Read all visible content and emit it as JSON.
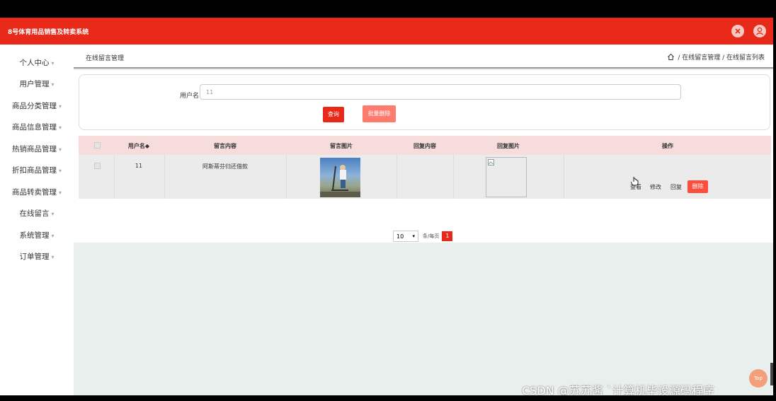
{
  "app": {
    "title": "8号体育用品销售及转卖系统"
  },
  "sidebar": {
    "items": [
      {
        "label": "个人中心"
      },
      {
        "label": "用户管理"
      },
      {
        "label": "商品分类管理"
      },
      {
        "label": "商品信息管理"
      },
      {
        "label": "热销商品管理"
      },
      {
        "label": "折扣商品管理"
      },
      {
        "label": "商品转卖管理"
      },
      {
        "label": "在线留言"
      },
      {
        "label": "系统管理"
      },
      {
        "label": "订单管理"
      }
    ],
    "caret": "▾"
  },
  "header": {
    "page_title": "在线留言管理",
    "breadcrumb": "/ 在线留言管理 / 在线留言列表"
  },
  "search": {
    "label": "用户名",
    "value": "11",
    "query_label": "查询",
    "batch_delete_label": "批量删除"
  },
  "table": {
    "columns": [
      "用户名◆",
      "留言内容",
      "留言图片",
      "回复内容",
      "回复图片",
      "操作"
    ],
    "rows": [
      {
        "username": "11",
        "content": "阿斯蒂芬归还借款",
        "reply": ""
      }
    ],
    "actions": {
      "view": "查看",
      "edit": "修改",
      "reply": "回复",
      "delete": "删除"
    }
  },
  "pagination": {
    "page_size": "10",
    "label": "条/每页",
    "current": "1"
  },
  "watermark": "CSDN @苏苏酱    `计算机毕设源码程序",
  "float_button": "Top",
  "colors": {
    "primary": "#e8291a",
    "header_row": "#f7dcdc",
    "content_bg": "#e8efec"
  }
}
